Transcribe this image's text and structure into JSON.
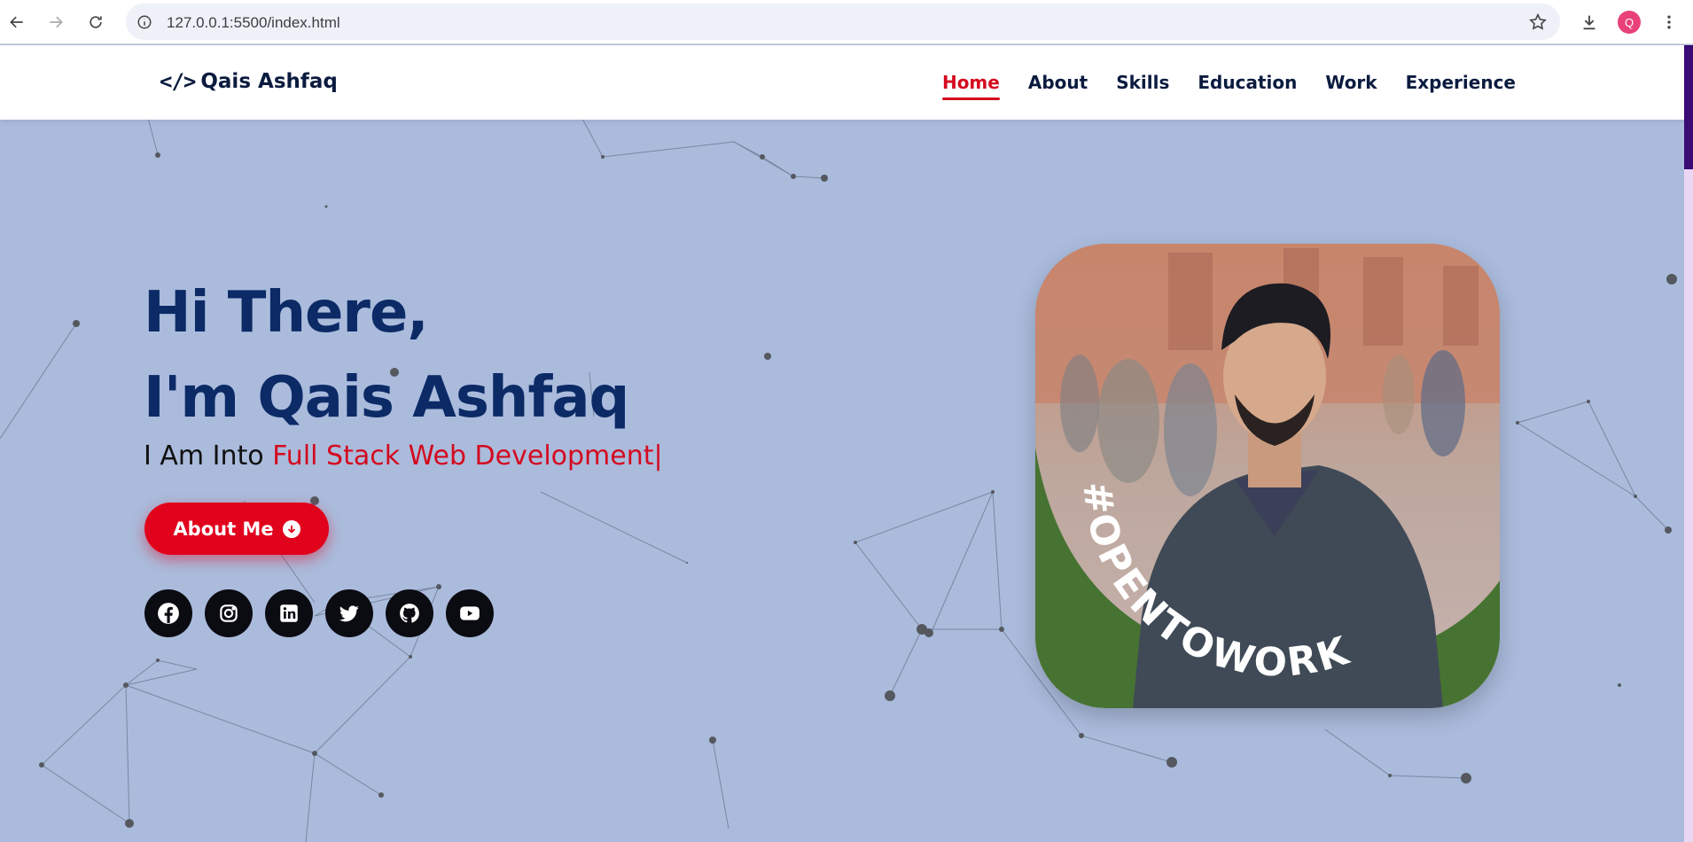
{
  "browser": {
    "url": "127.0.0.1:5500/index.html",
    "profile_initial": "Q"
  },
  "site": {
    "logo_icon": "</>",
    "logo_text": "Qais Ashfaq",
    "menu": [
      {
        "label": "Home",
        "active": true
      },
      {
        "label": "About",
        "active": false
      },
      {
        "label": "Skills",
        "active": false
      },
      {
        "label": "Education",
        "active": false
      },
      {
        "label": "Work",
        "active": false
      },
      {
        "label": "Experience",
        "active": false
      }
    ]
  },
  "hero": {
    "greeting_line1": "Hi There,",
    "greeting_line2": "I'm Qais Ashfaq",
    "into_prefix": "I Am Into ",
    "into_highlight": "Full Stack Web Development|",
    "button_label": "About Me",
    "socials": [
      "facebook-icon",
      "instagram-icon",
      "linkedin-icon",
      "twitter-icon",
      "github-icon",
      "youtube-icon"
    ],
    "photo_badge": "#OPENTOWORK"
  },
  "colors": {
    "accent": "#d40a1f",
    "heading": "#0b2a66",
    "hero_bg": "#aabbdc",
    "badge_green": "#467332"
  }
}
